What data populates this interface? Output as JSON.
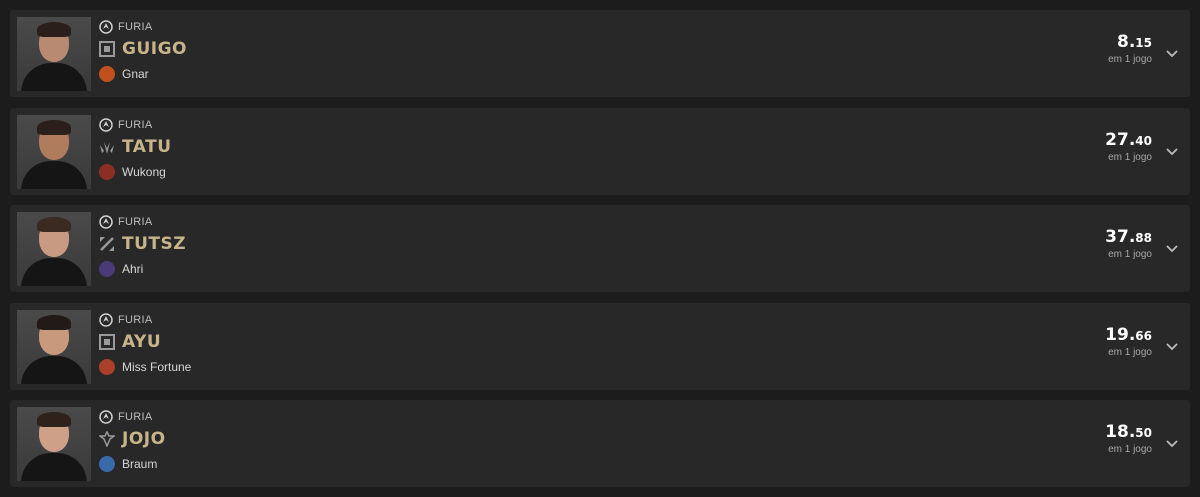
{
  "players": [
    {
      "team": "FURIA",
      "name": "GUIGO",
      "role_icon": "top-lane-icon",
      "champion": "Gnar",
      "champion_color": "#c0511f",
      "score_int": "8.",
      "score_dec": "15",
      "games": "em 1 jogo"
    },
    {
      "team": "FURIA",
      "name": "TATU",
      "role_icon": "jungle-icon",
      "champion": "Wukong",
      "champion_color": "#8c2e24",
      "score_int": "27.",
      "score_dec": "40",
      "games": "em 1 jogo"
    },
    {
      "team": "FURIA",
      "name": "TUTSZ",
      "role_icon": "mid-lane-icon",
      "champion": "Ahri",
      "champion_color": "#4a3a78",
      "score_int": "37.",
      "score_dec": "88",
      "games": "em 1 jogo"
    },
    {
      "team": "FURIA",
      "name": "AYU",
      "role_icon": "bot-lane-icon",
      "champion": "Miss Fortune",
      "champion_color": "#a8402a",
      "score_int": "19.",
      "score_dec": "66",
      "games": "em 1 jogo"
    },
    {
      "team": "FURIA",
      "name": "JOJO",
      "role_icon": "support-icon",
      "champion": "Braum",
      "champion_color": "#3a6aa8",
      "score_int": "18.",
      "score_dec": "50",
      "games": "em 1 jogo"
    }
  ]
}
